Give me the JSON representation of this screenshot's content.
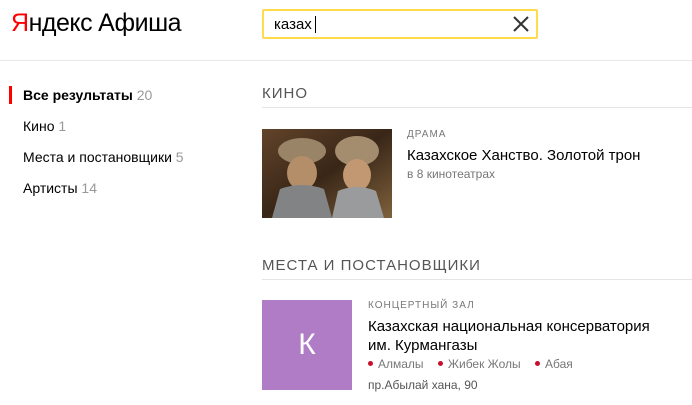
{
  "header": {
    "brand_first": "Я",
    "brand_rest": "ндекс",
    "product": "Афиша",
    "search": {
      "value": "казах",
      "placeholder": ""
    }
  },
  "sidebar": {
    "items": [
      {
        "label": "Все результаты",
        "count": "20",
        "active": true
      },
      {
        "label": "Кино",
        "count": "1",
        "active": false
      },
      {
        "label": "Места и постановщики",
        "count": "5",
        "active": false
      },
      {
        "label": "Артисты",
        "count": "14",
        "active": false
      }
    ]
  },
  "sections": {
    "movies": {
      "title": "КИНО",
      "items": [
        {
          "genre": "ДРАМА",
          "title": "Казахское Ханство. Золотой трон",
          "meta": "в 8 кинотеатрах"
        }
      ]
    },
    "places": {
      "title": "МЕСТА И ПОСТАНОВЩИКИ",
      "items": [
        {
          "tile_letter": "К",
          "tile_color": "#b07cc6",
          "category": "КОНЦЕРТНЫЙ ЗАЛ",
          "title_line1": "Казахская национальная консерватория",
          "title_line2": "им. Курмангазы",
          "metro": [
            "Алмалы",
            "Жибек Жолы",
            "Абая"
          ],
          "metro_color": "#c8102e",
          "address": "пр.Абылай хана, 90"
        }
      ]
    }
  },
  "colors": {
    "accent": "#ffdb4d",
    "brand": "#ff0000"
  }
}
